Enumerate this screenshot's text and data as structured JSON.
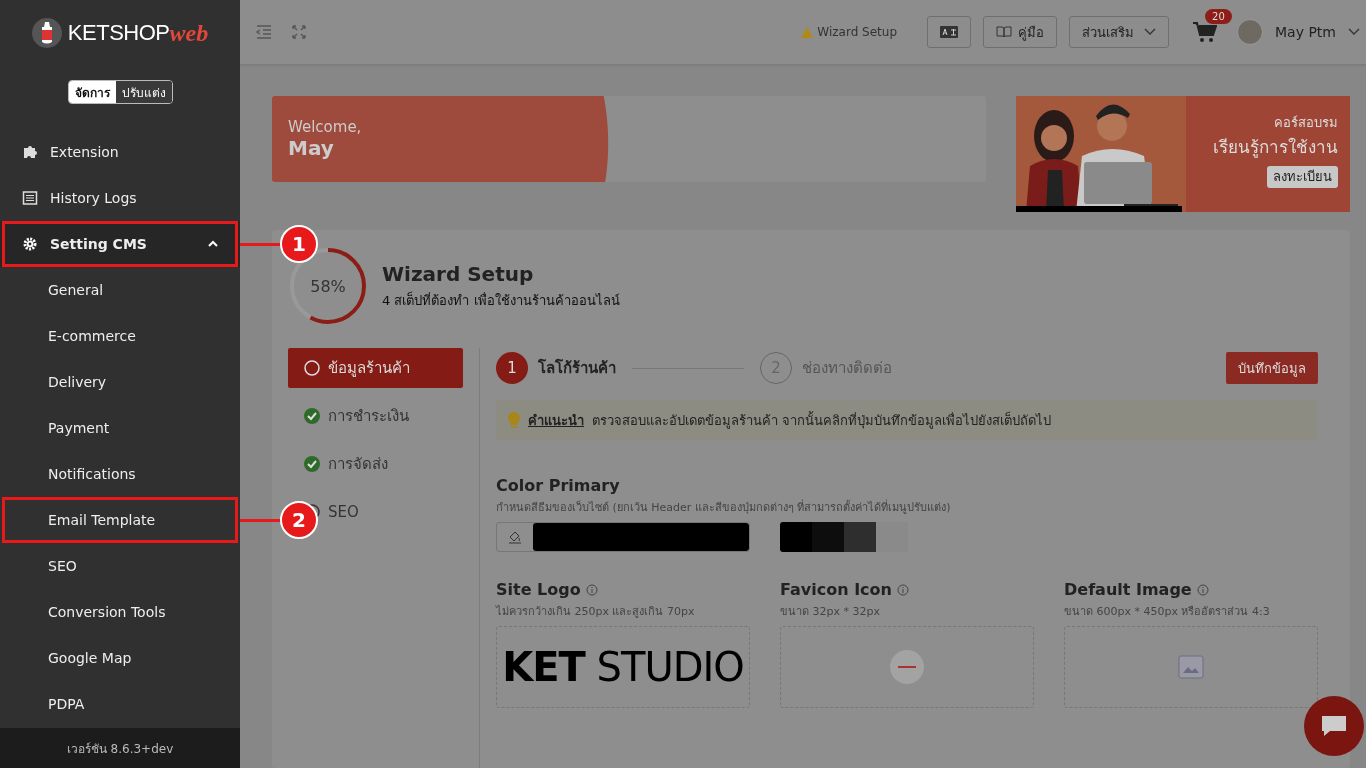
{
  "sidebar": {
    "logo": {
      "text": "KETSHOP",
      "accent": "web"
    },
    "mode_toggle": [
      {
        "label": "จัดการ",
        "selected": true
      },
      {
        "label": "ปรับแต่ง",
        "selected": false
      }
    ],
    "items": [
      {
        "label": "Extension"
      },
      {
        "label": "History Logs"
      },
      {
        "label": "Setting CMS",
        "expanded": true,
        "callout": "1",
        "children": [
          {
            "label": "General"
          },
          {
            "label": "E-commerce"
          },
          {
            "label": "Delivery"
          },
          {
            "label": "Payment"
          },
          {
            "label": "Notifications"
          },
          {
            "label": "Email Template",
            "callout": "2"
          },
          {
            "label": "SEO"
          },
          {
            "label": "Conversion Tools"
          },
          {
            "label": "Google Map"
          },
          {
            "label": "PDPA"
          }
        ]
      }
    ],
    "version": "เวอร์ชัน 8.6.3+dev"
  },
  "header": {
    "wizard_link": "Wizard Setup",
    "manual_button": "คู่มือ",
    "addons_button": "ส่วนเสริม",
    "cart_count": "20",
    "user": "May Ptm"
  },
  "welcome": {
    "greeting": "Welcome,",
    "name": "May"
  },
  "course_banner": {
    "subtitle": "คอร์สอบรม",
    "title": "เรียนรู้การใช้งาน",
    "button": "ลงทะเบียน",
    "kind": "picture"
  },
  "wizard": {
    "progress_text": "58%",
    "level": 0.58,
    "title": "Wizard Setup",
    "subtitle": "4 สเต็ปที่ต้องทำ เพื่อใช้งานร้านค้าออนไลน์",
    "steps": [
      {
        "label": "ข้อมูลร้านค้า",
        "selected": true,
        "done": false
      },
      {
        "label": "การชำระเงิน",
        "selected": false,
        "done": true
      },
      {
        "label": "การจัดส่ง",
        "selected": false,
        "done": true
      },
      {
        "label": "SEO",
        "selected": false,
        "done": false
      }
    ],
    "substeps": [
      {
        "number": "1",
        "label": "โลโก้ร้านค้า",
        "selected": true
      },
      {
        "number": "2",
        "label": "ช่องทางติดต่อ",
        "selected": false
      }
    ],
    "save_button": "บันทึกข้อมูล",
    "tip": {
      "label": "คำแนะนำ",
      "text": "ตรวจสอบและอัปเดตข้อมูลร้านค้า จากนั้นคลิกที่ปุ่มบันทึกข้อมูลเพื่อไปยังสเต็ปถัดไป"
    },
    "color_primary": {
      "title": "Color Primary",
      "hint": "กำหนดสีธีมของเว็บไซต์ (ยกเว้น Header และสีของปุ่มกดต่างๆ ที่สามารถตั้งค่าได้ที่เมนูปรับแต่ง)",
      "color": "#000000",
      "swatches": [
        {
          "color": "#000000"
        },
        {
          "color": "#0d0d0d"
        },
        {
          "color": "#2e2e2e"
        },
        {
          "color": "#8a8a8a"
        }
      ]
    },
    "images": [
      {
        "title": "Site Logo",
        "hint": "ไม่ควรกว้างเกิน 250px และสูงเกิน 70px",
        "kind": "logo",
        "preview_text": "**KET** STUDIO"
      },
      {
        "title": "Favicon Icon",
        "hint": "ขนาด 32px * 32px",
        "kind": "favicon"
      },
      {
        "title": "Default Image",
        "hint": "ขนาด 600px * 450px หรืออัตราส่วน 4:3",
        "kind": "placeholder"
      }
    ]
  }
}
